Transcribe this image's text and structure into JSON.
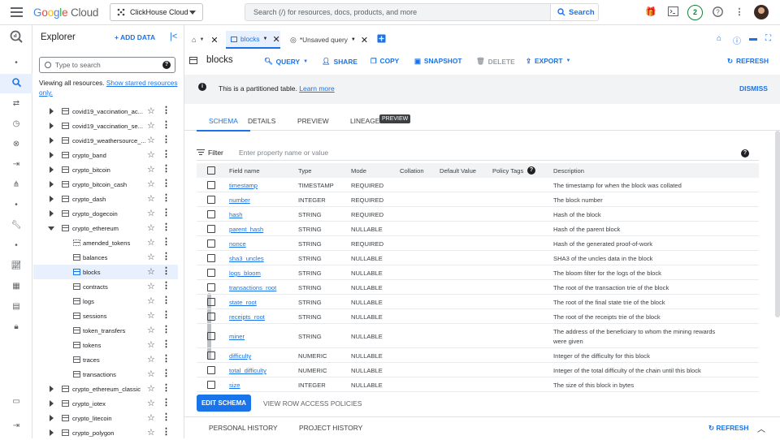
{
  "topbar": {
    "logo_google": "Google",
    "logo_cloud": "Cloud",
    "project": "ClickHouse Cloud",
    "search_placeholder": "Search (/) for resources, docs, products, and more",
    "search_button": "Search",
    "notification_count": "2"
  },
  "explorer": {
    "title": "Explorer",
    "add_data": "+ ADD DATA",
    "filter_placeholder": "Type to search",
    "viewing_text": "Viewing all resources.",
    "starred_link": "Show starred resources only.",
    "items": [
      {
        "label": "covid19_vaccination_ac...",
        "level": 1,
        "expand": "right"
      },
      {
        "label": "covid19_vaccination_se...",
        "level": 1,
        "expand": "right"
      },
      {
        "label": "covid19_weathersource_...",
        "level": 1,
        "expand": "right"
      },
      {
        "label": "crypto_band",
        "level": 1,
        "expand": "right"
      },
      {
        "label": "crypto_bitcoin",
        "level": 1,
        "expand": "right"
      },
      {
        "label": "crypto_bitcoin_cash",
        "level": 1,
        "expand": "right"
      },
      {
        "label": "crypto_dash",
        "level": 1,
        "expand": "right"
      },
      {
        "label": "crypto_dogecoin",
        "level": 1,
        "expand": "right"
      },
      {
        "label": "crypto_ethereum",
        "level": 1,
        "expand": "down"
      },
      {
        "label": "amended_tokens",
        "level": 2,
        "kind": "view"
      },
      {
        "label": "balances",
        "level": 2
      },
      {
        "label": "blocks",
        "level": 2,
        "selected": true
      },
      {
        "label": "contracts",
        "level": 2
      },
      {
        "label": "logs",
        "level": 2
      },
      {
        "label": "sessions",
        "level": 2
      },
      {
        "label": "token_transfers",
        "level": 2
      },
      {
        "label": "tokens",
        "level": 2
      },
      {
        "label": "traces",
        "level": 2
      },
      {
        "label": "transactions",
        "level": 2
      },
      {
        "label": "crypto_ethereum_classic",
        "level": 1,
        "expand": "right"
      },
      {
        "label": "crypto_iotex",
        "level": 1,
        "expand": "right"
      },
      {
        "label": "crypto_litecoin",
        "level": 1,
        "expand": "right"
      },
      {
        "label": "crypto_polygon",
        "level": 1,
        "expand": "right"
      }
    ]
  },
  "tabs": {
    "blocks_tab": "blocks",
    "unsaved_tab": "*Unsaved query"
  },
  "toolbar": {
    "table_title": "blocks",
    "query": "QUERY",
    "share": "SHARE",
    "copy": "COPY",
    "snapshot": "SNAPSHOT",
    "delete": "DELETE",
    "export": "EXPORT",
    "refresh": "REFRESH"
  },
  "banner": {
    "message": "This is a partitioned table.",
    "link": "Learn more",
    "dismiss": "DISMISS"
  },
  "subtabs": {
    "schema": "SCHEMA",
    "details": "DETAILS",
    "preview": "PREVIEW",
    "lineage": "LINEAGE",
    "lineage_badge": "PREVIEW"
  },
  "filter": {
    "label": "Filter",
    "placeholder": "Enter property name or value"
  },
  "schema": {
    "headers": {
      "field_name": "Field name",
      "type": "Type",
      "mode": "Mode",
      "collation": "Collation",
      "default_value": "Default Value",
      "policy_tags": "Policy Tags",
      "description": "Description"
    },
    "rows": [
      {
        "name": "timestamp",
        "type": "TIMESTAMP",
        "mode": "REQUIRED",
        "desc": "The timestamp for when the block was collated"
      },
      {
        "name": "number",
        "type": "INTEGER",
        "mode": "REQUIRED",
        "desc": "The block number"
      },
      {
        "name": "hash",
        "type": "STRING",
        "mode": "REQUIRED",
        "desc": "Hash of the block"
      },
      {
        "name": "parent_hash",
        "type": "STRING",
        "mode": "NULLABLE",
        "desc": "Hash of the parent block"
      },
      {
        "name": "nonce",
        "type": "STRING",
        "mode": "REQUIRED",
        "desc": "Hash of the generated proof-of-work"
      },
      {
        "name": "sha3_uncles",
        "type": "STRING",
        "mode": "NULLABLE",
        "desc": "SHA3 of the uncles data in the block"
      },
      {
        "name": "logs_bloom",
        "type": "STRING",
        "mode": "NULLABLE",
        "desc": "The bloom filter for the logs of the block"
      },
      {
        "name": "transactions_root",
        "type": "STRING",
        "mode": "NULLABLE",
        "desc": "The root of the transaction trie of the block"
      },
      {
        "name": "state_root",
        "type": "STRING",
        "mode": "NULLABLE",
        "desc": "The root of the final state trie of the block"
      },
      {
        "name": "receipts_root",
        "type": "STRING",
        "mode": "NULLABLE",
        "desc": "The root of the receipts trie of the block"
      },
      {
        "name": "miner",
        "type": "STRING",
        "mode": "NULLABLE",
        "desc": "The address of the beneficiary to whom the mining rewards",
        "desc2": "were given"
      },
      {
        "name": "difficulty",
        "type": "NUMERIC",
        "mode": "NULLABLE",
        "desc": "Integer of the difficulty for this block"
      },
      {
        "name": "total_difficulty",
        "type": "NUMERIC",
        "mode": "NULLABLE",
        "desc": "Integer of the total difficulty of the chain until this block"
      },
      {
        "name": "size",
        "type": "INTEGER",
        "mode": "NULLABLE",
        "desc": "The size of this block in bytes"
      }
    ]
  },
  "actions": {
    "edit_schema": "EDIT SCHEMA",
    "row_access": "VIEW ROW ACCESS POLICIES"
  },
  "bottom": {
    "personal_history": "PERSONAL HISTORY",
    "project_history": "PROJECT HISTORY",
    "refresh": "REFRESH"
  },
  "colors": {
    "accent": "#1a73e8",
    "selected_bg": "#e8f0fe",
    "green_badge": "#188038"
  }
}
